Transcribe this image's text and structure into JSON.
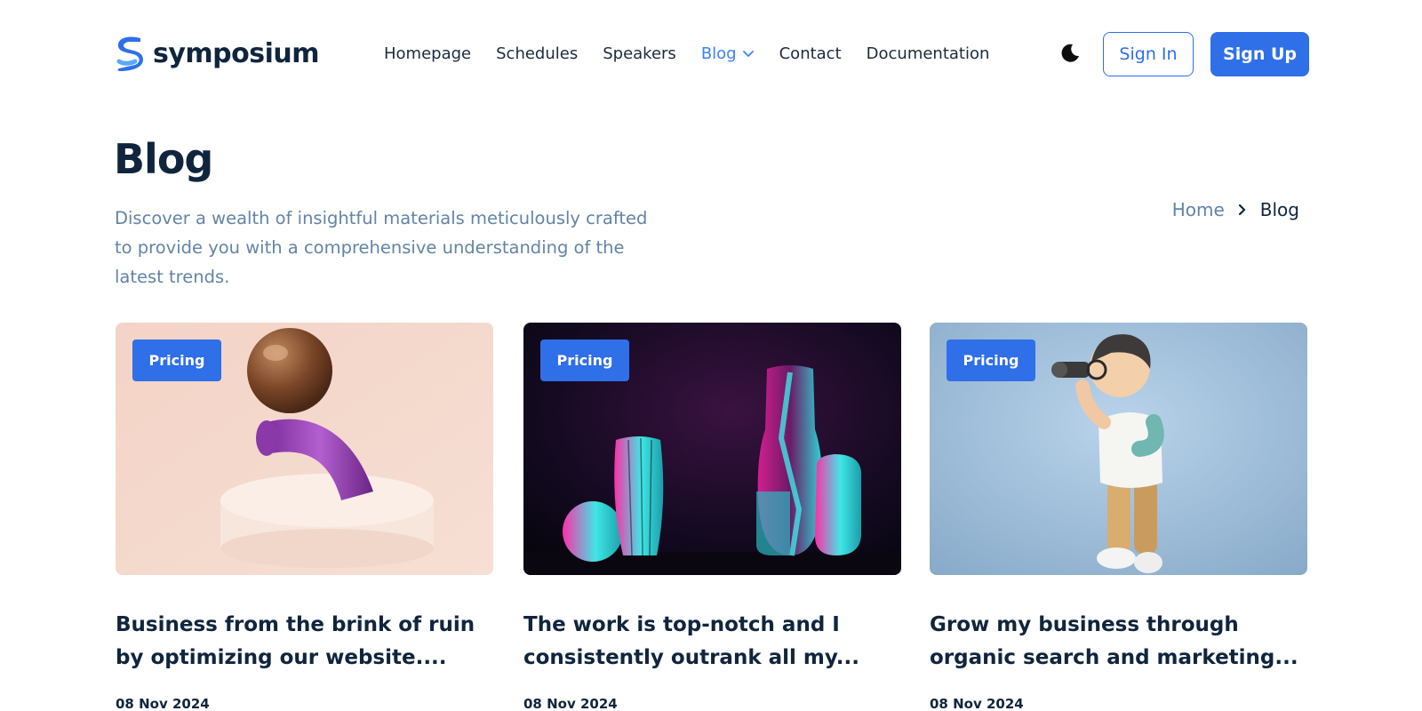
{
  "brand": {
    "name": "symposium"
  },
  "nav": {
    "items": [
      {
        "label": "Homepage"
      },
      {
        "label": "Schedules"
      },
      {
        "label": "Speakers"
      },
      {
        "label": "Blog"
      },
      {
        "label": "Contact"
      },
      {
        "label": "Documentation"
      }
    ],
    "active": "Blog"
  },
  "header": {
    "theme_icon": "moon-icon",
    "sign_in_label": "Sign In",
    "sign_up_label": "Sign Up"
  },
  "hero": {
    "title": "Blog",
    "description": "Discover a wealth of insightful materials meticulously crafted to provide you with a comprehensive understanding of the latest trends."
  },
  "breadcrumb": {
    "home": "Home",
    "current": "Blog"
  },
  "posts": [
    {
      "tag": "Pricing",
      "title": "Business from the brink of ruin by optimizing our website....",
      "date": "08 Nov 2024"
    },
    {
      "tag": "Pricing",
      "title": "The work is top-notch and I consistently outrank all my...",
      "date": "08 Nov 2024"
    },
    {
      "tag": "Pricing",
      "title": "Grow my business through organic search and marketing...",
      "date": "08 Nov 2024"
    }
  ],
  "colors": {
    "primary": "#2f6fe8",
    "heading": "#10253d",
    "muted": "#6384a6"
  }
}
